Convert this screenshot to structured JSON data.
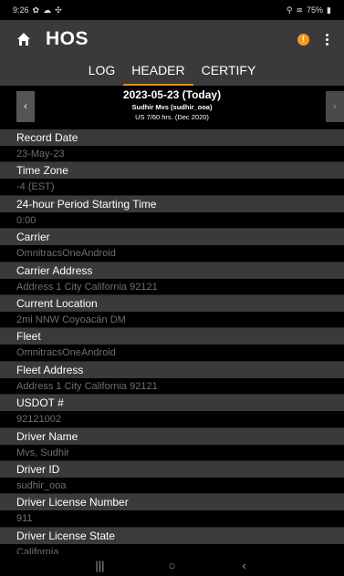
{
  "status_bar": {
    "time": "9:26",
    "left_icons": [
      "settings-icon",
      "cloud-icon",
      "location-icon"
    ],
    "battery": "75%"
  },
  "app_bar": {
    "title": "HOS",
    "alert_glyph": "!"
  },
  "tabs": [
    {
      "label": "LOG",
      "active": false
    },
    {
      "label": "HEADER",
      "active": true
    },
    {
      "label": "CERTIFY",
      "active": false
    }
  ],
  "date_header": {
    "date": "2023-05-23 (Today)",
    "driver": "Sudhir Mvs (sudhir_ooa)",
    "rule": "US 7/60 hrs. (Dec 2020)",
    "prev_glyph": "‹",
    "next_glyph": "›"
  },
  "fields": [
    {
      "label": "Record Date",
      "value": "23-May-23"
    },
    {
      "label": "Time Zone",
      "value": "-4 (EST)"
    },
    {
      "label": "24-hour Period Starting Time",
      "value": "0:00"
    },
    {
      "label": "Carrier",
      "value": "OmnitracsOneAndroid"
    },
    {
      "label": "Carrier Address",
      "value": "Address 1  City California 92121"
    },
    {
      "label": "Current Location",
      "value": "2mi NNW Coyoacán DM"
    },
    {
      "label": "Fleet",
      "value": "OmnitracsOneAndroid"
    },
    {
      "label": "Fleet Address",
      "value": "Address 1 City California 92121"
    },
    {
      "label": "USDOT #",
      "value": "92121002"
    },
    {
      "label": "Driver Name",
      "value": "Mvs, Sudhir"
    },
    {
      "label": "Driver ID",
      "value": "sudhir_ooa"
    },
    {
      "label": "Driver License Number",
      "value": "911"
    },
    {
      "label": "Driver License State",
      "value": "California"
    }
  ],
  "nav_bar": {
    "recents": "|||",
    "home": "○",
    "back": "‹"
  },
  "colors": {
    "accent": "#e58a2c",
    "alert": "#f29a2b",
    "label_bg": "#3a3a3a",
    "value_text": "#6f6f6f"
  }
}
